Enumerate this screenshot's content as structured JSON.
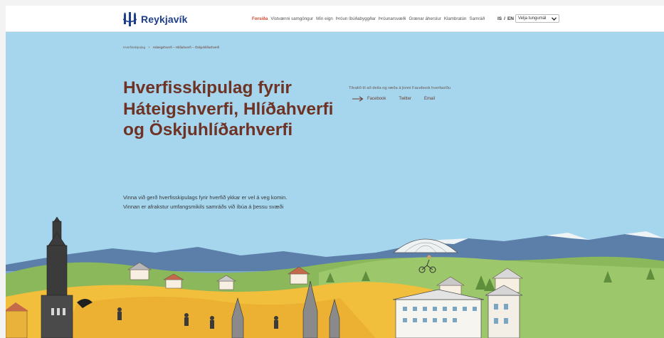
{
  "header": {
    "brand": "Reykjavík",
    "nav": [
      {
        "label": "Forsíða",
        "active": true
      },
      {
        "label": "Vistvænni samgöngur",
        "active": false
      },
      {
        "label": "Mín eign",
        "active": false
      },
      {
        "label": "Þróun íbúðabyggðar",
        "active": false
      },
      {
        "label": "Þróunarsvæði",
        "active": false
      },
      {
        "label": "Grænar áherslur",
        "active": false
      },
      {
        "label": "Klambratún",
        "active": false
      },
      {
        "label": "Samráð",
        "active": false
      }
    ],
    "lang_is": "IS",
    "lang_sep": "/",
    "lang_en": "EN",
    "language_select": "Velja tungumál"
  },
  "breadcrumb": {
    "home": "Hverfisskipulag",
    "separator": ">",
    "current": "Háteigshverfi – Hlíðahverfi – Öskjuhlíðarhverfi"
  },
  "hero": {
    "title": "Hverfisskipulag fyrir Háteigshverfi, Hlíðahverfi og Öskjuhlíðarhverfi",
    "intro": "Vinna við gerð hverfisskipulags fyrir hverfið ykkar er vel á veg komin. Vinnan er afrakstur umfangsmikils samráðs við íbúa á þessu svæði",
    "share_label": "Tilvalið til að deila og ræða á þinni Facebook hverfasíðu",
    "share_facebook": "Facebook",
    "share_twitter": "Twitter",
    "share_email": "Email"
  },
  "colors": {
    "brand_blue": "#1d3f8a",
    "accent_red": "#d1462e",
    "title_brown": "#6e3324",
    "sky": "#a6d6ee",
    "field_yellow": "#f2bf3c",
    "hill_green": "#8ab85a"
  },
  "icons": [
    "reykjavik-logo-icon",
    "chevron-down-icon",
    "arrow-right-icon"
  ]
}
